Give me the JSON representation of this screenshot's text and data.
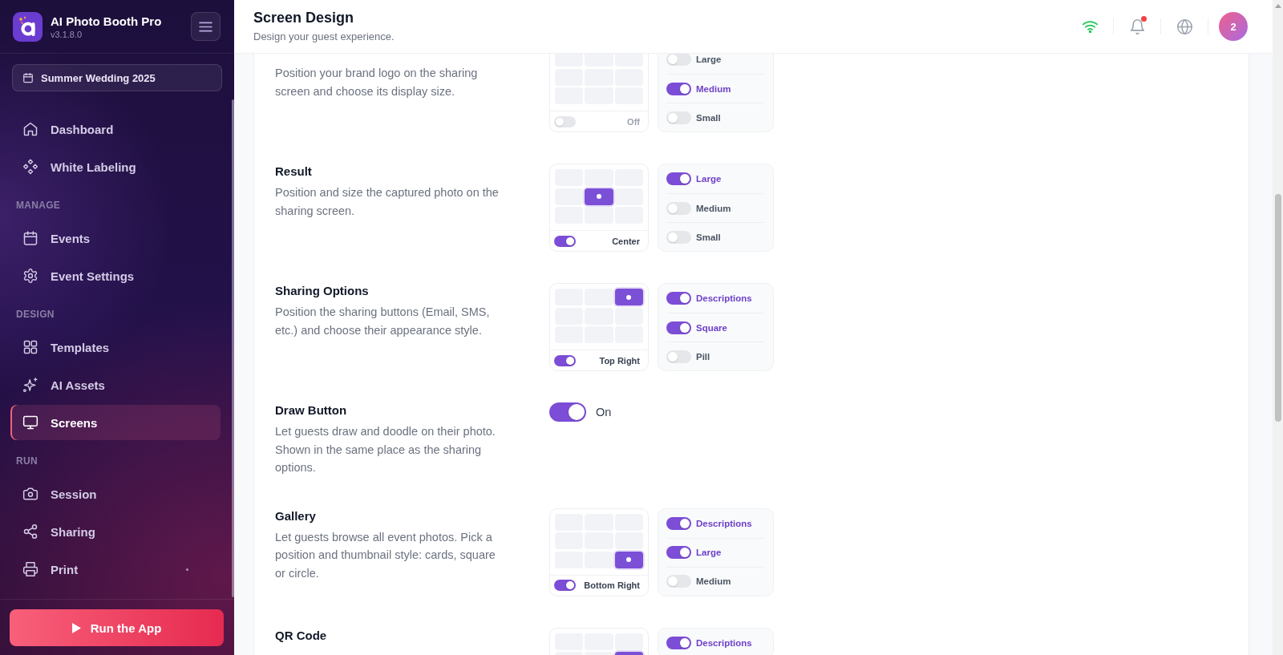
{
  "sidebar": {
    "app_name": "AI Photo Booth Pro",
    "version": "v3.1.8.0",
    "event": "Summer Wedding 2025",
    "groups": [
      {
        "items": [
          {
            "label": "Dashboard",
            "selected": false
          },
          {
            "label": "White Labeling",
            "selected": false
          }
        ]
      },
      {
        "heading": "MANAGE",
        "items": [
          {
            "label": "Events",
            "selected": false
          },
          {
            "label": "Event Settings",
            "selected": false
          }
        ]
      },
      {
        "heading": "DESIGN",
        "items": [
          {
            "label": "Templates",
            "selected": false
          },
          {
            "label": "AI Assets",
            "selected": false
          },
          {
            "label": "Screens",
            "selected": true
          }
        ]
      },
      {
        "heading": "RUN",
        "items": [
          {
            "label": "Session",
            "selected": false
          },
          {
            "label": "Sharing",
            "selected": false
          },
          {
            "label": "Print",
            "selected": false,
            "dot": true
          }
        ]
      }
    ],
    "run_button": "Run the App"
  },
  "header": {
    "title": "Screen Design",
    "subtitle": "Design your guest experience.",
    "online": true,
    "unread_notifications": true,
    "avatar": "2"
  },
  "sections": [
    {
      "kind": "placement",
      "description": "Position your brand logo on the sharing screen and choose its display size.",
      "cells": [
        {
          "selected": false
        },
        {
          "selected": false
        },
        {
          "selected": false
        },
        {
          "selected": false
        },
        {
          "selected": false
        },
        {
          "selected": false
        },
        {
          "selected": false
        },
        {
          "selected": false
        },
        {
          "selected": false
        }
      ],
      "enabled": false,
      "position": "Off",
      "options": [
        {
          "label": "Large",
          "on": false
        },
        {
          "label": "Medium",
          "on": true
        },
        {
          "label": "Small",
          "on": false
        }
      ]
    },
    {
      "kind": "placement",
      "title": "Result",
      "description": "Position and size the captured photo on the sharing screen.",
      "cells": [
        {
          "selected": false
        },
        {
          "selected": false
        },
        {
          "selected": false
        },
        {
          "selected": false
        },
        {
          "selected": true
        },
        {
          "selected": false
        },
        {
          "selected": false
        },
        {
          "selected": false
        },
        {
          "selected": false
        }
      ],
      "enabled": true,
      "position": "Center",
      "options": [
        {
          "label": "Large",
          "on": true
        },
        {
          "label": "Medium",
          "on": false
        },
        {
          "label": "Small",
          "on": false
        }
      ]
    },
    {
      "kind": "placement",
      "title": "Sharing Options",
      "description": "Position the sharing buttons (Email, SMS, etc.) and choose their appearance style.",
      "cells": [
        {
          "selected": false
        },
        {
          "selected": false
        },
        {
          "selected": true
        },
        {
          "selected": false
        },
        {
          "selected": false
        },
        {
          "selected": false
        },
        {
          "selected": false
        },
        {
          "selected": false
        },
        {
          "selected": false
        }
      ],
      "enabled": true,
      "position": "Top Right",
      "options": [
        {
          "label": "Descriptions",
          "on": true
        },
        {
          "label": "Square",
          "on": true
        },
        {
          "label": "Pill",
          "on": false
        }
      ]
    },
    {
      "kind": "switch",
      "title": "Draw Button",
      "description": "Let guests draw and doodle on their photo. Shown in the same place as the sharing options.",
      "on": true,
      "state": "On"
    },
    {
      "kind": "placement",
      "title": "Gallery",
      "description": "Let guests browse all event photos. Pick a position and thumbnail style: cards, square or circle.",
      "cells": [
        {
          "selected": false
        },
        {
          "selected": false
        },
        {
          "selected": false
        },
        {
          "selected": false
        },
        {
          "selected": false
        },
        {
          "selected": false
        },
        {
          "selected": false
        },
        {
          "selected": false
        },
        {
          "selected": true
        }
      ],
      "enabled": true,
      "position": "Bottom Right",
      "options": [
        {
          "label": "Descriptions",
          "on": true
        },
        {
          "label": "Large",
          "on": true
        },
        {
          "label": "Medium",
          "on": false
        }
      ]
    },
    {
      "kind": "placement",
      "title": "QR Code",
      "cells": [
        {
          "selected": false
        },
        {
          "selected": false
        },
        {
          "selected": false
        },
        {
          "selected": false
        },
        {
          "selected": false
        },
        {
          "selected": true
        }
      ],
      "options": [
        {
          "label": "Descriptions",
          "on": true
        }
      ]
    }
  ]
}
